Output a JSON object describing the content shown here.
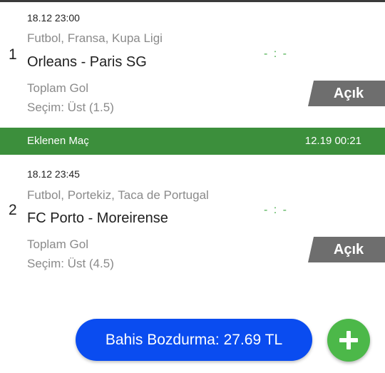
{
  "bets": [
    {
      "number": "1",
      "datetime": "18.12 23:00",
      "league": "Futbol,  Fransa,  Kupa Ligi",
      "teams": "Orleans - Paris SG",
      "score": "- : -",
      "market": "Toplam Gol",
      "selection": "Seçim: Üst (1.5)",
      "status": "Açık"
    },
    {
      "number": "2",
      "datetime": "18.12 23:45",
      "league": "Futbol,  Portekiz,  Taca de Portugal",
      "teams": "FC Porto - Moreirense",
      "score": "- : -",
      "market": "Toplam Gol",
      "selection": "Seçim: Üst (4.5)",
      "status": "Açık"
    }
  ],
  "added_bar": {
    "label": "Eklenen Maç",
    "time": "12.19 00:21"
  },
  "cashout": {
    "label": "Bahis Bozdurma: 27.69 TL"
  },
  "colors": {
    "score_green": "#4caf50",
    "added_bar_bg": "#3c8f3c",
    "status_bg": "#6e6e6e",
    "cashout_bg": "#0a4cf0",
    "add_button_bg": "#4cb849"
  },
  "icons": {
    "add": "plus-icon"
  }
}
